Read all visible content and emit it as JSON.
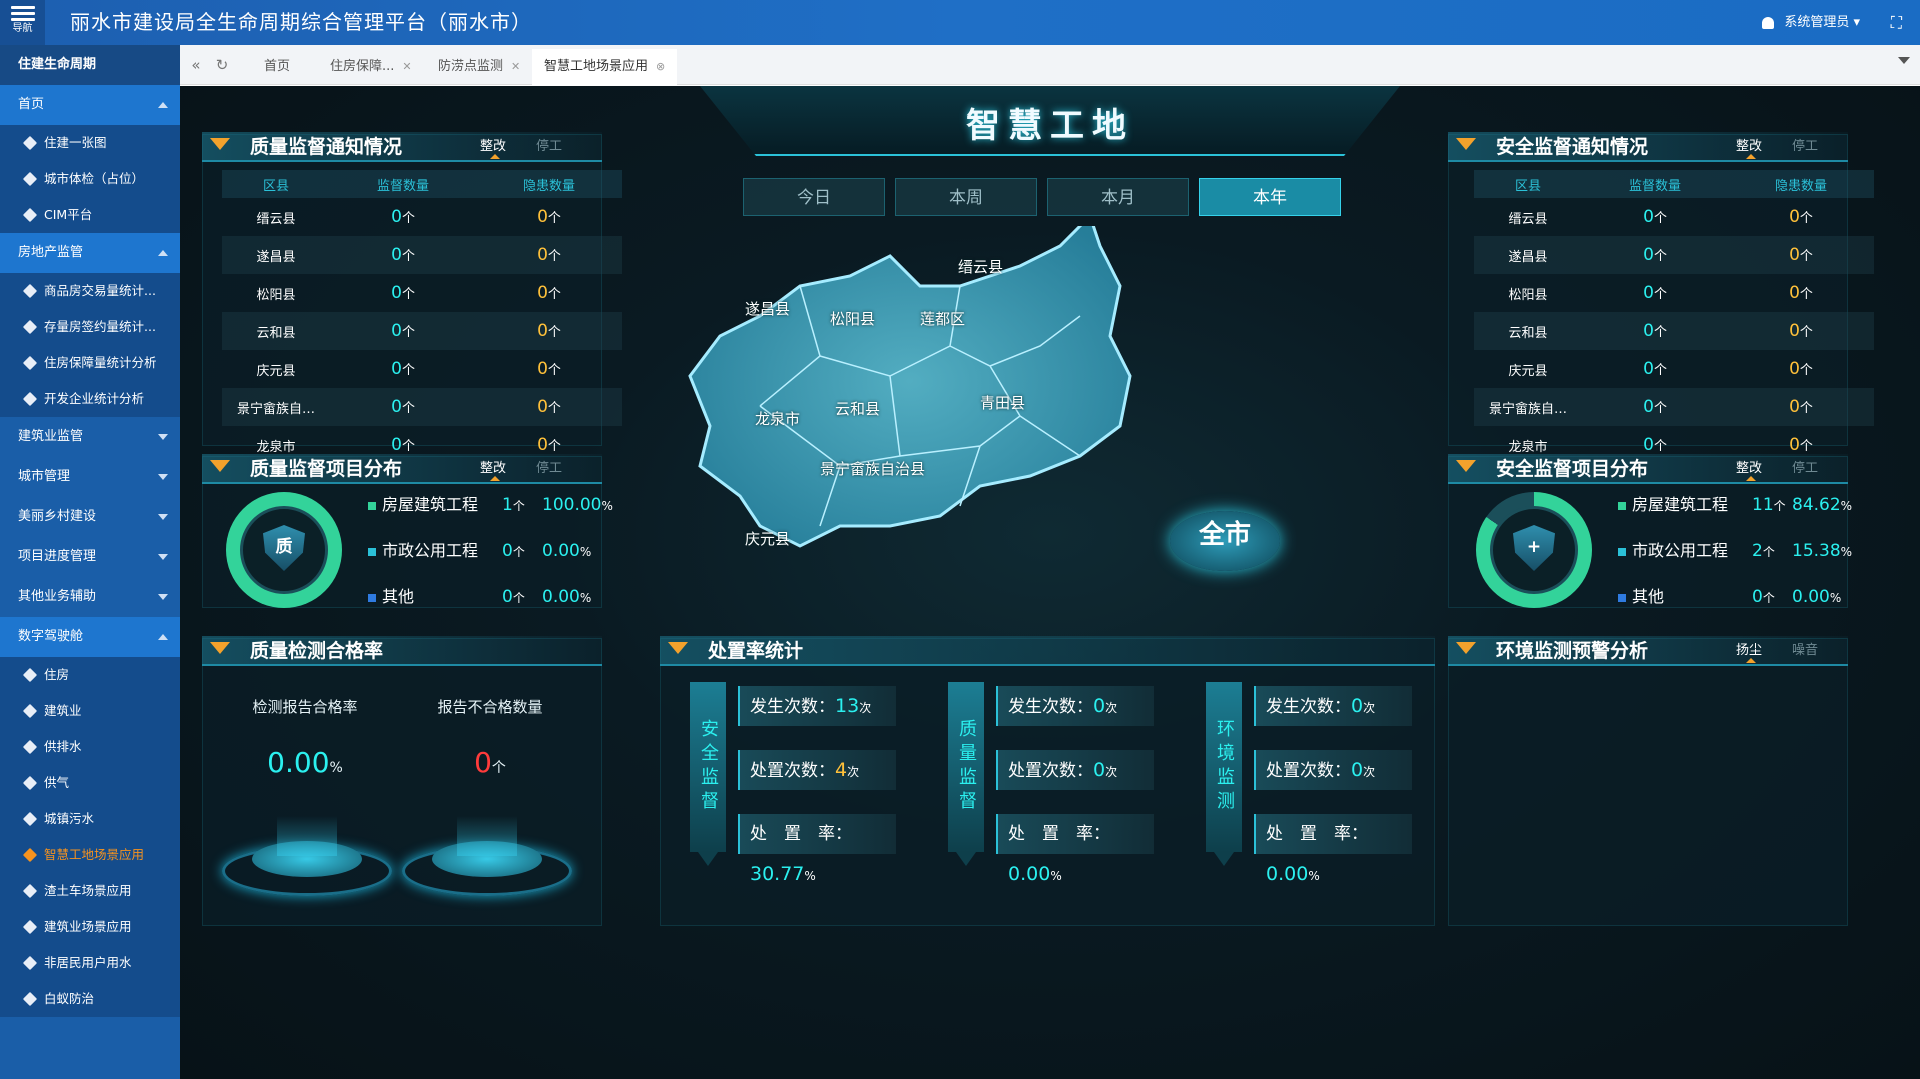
{
  "app": {
    "title": "丽水市建设局全生命周期综合管理平台（丽水市）",
    "menu_label": "导航",
    "user": "系统管理员"
  },
  "sidebar": {
    "head": "住建生命周期",
    "groups": [
      {
        "label": "首页",
        "open": true,
        "items": [
          "住建一张图",
          "城市体检（占位）",
          "CIM平台"
        ]
      },
      {
        "label": "房地产监管",
        "open": true,
        "items": [
          "商品房交易量统计...",
          "存量房签约量统计...",
          "住房保障量统计分析",
          "开发企业统计分析"
        ]
      },
      {
        "label": "建筑业监管",
        "open": false,
        "items": []
      },
      {
        "label": "城市管理",
        "open": false,
        "items": []
      },
      {
        "label": "美丽乡村建设",
        "open": false,
        "items": []
      },
      {
        "label": "项目进度管理",
        "open": false,
        "items": []
      },
      {
        "label": "其他业务辅助",
        "open": false,
        "items": []
      },
      {
        "label": "数字驾驶舱",
        "open": true,
        "items": [
          "住房",
          "建筑业",
          "供排水",
          "供气",
          "城镇污水",
          "智慧工地场景应用",
          "渣土车场景应用",
          "建筑业场景应用",
          "非居民用户用水",
          "白蚁防治"
        ]
      }
    ],
    "active_item": "智慧工地场景应用"
  },
  "tabs": [
    "首页",
    "住房保障...",
    "防涝点监测",
    "智慧工地场景应用"
  ],
  "dashboard": {
    "title": "智慧工地",
    "periods": [
      "今日",
      "本周",
      "本月",
      "本年"
    ],
    "active_period": "本年",
    "switch_labels": {
      "fix": "整改",
      "stop": "停工",
      "dust": "扬尘",
      "noise": "噪音"
    },
    "quality_notice": {
      "title": "质量监督通知情况",
      "headers": [
        "区县",
        "监督数量",
        "隐患数量"
      ],
      "rows": [
        {
          "area": "缙云县",
          "sup": "0",
          "risk": "0"
        },
        {
          "area": "遂昌县",
          "sup": "0",
          "risk": "0"
        },
        {
          "area": "松阳县",
          "sup": "0",
          "risk": "0"
        },
        {
          "area": "云和县",
          "sup": "0",
          "risk": "0"
        },
        {
          "area": "庆元县",
          "sup": "0",
          "risk": "0"
        },
        {
          "area": "景宁畲族自…",
          "sup": "0",
          "risk": "0"
        },
        {
          "area": "龙泉市",
          "sup": "0",
          "risk": "0"
        }
      ],
      "unit": "个"
    },
    "safety_notice": {
      "title": "安全监督通知情况",
      "headers": [
        "区县",
        "监督数量",
        "隐患数量"
      ],
      "rows": [
        {
          "area": "缙云县",
          "sup": "0",
          "risk": "0"
        },
        {
          "area": "遂昌县",
          "sup": "0",
          "risk": "0"
        },
        {
          "area": "松阳县",
          "sup": "0",
          "risk": "0"
        },
        {
          "area": "云和县",
          "sup": "0",
          "risk": "0"
        },
        {
          "area": "庆元县",
          "sup": "0",
          "risk": "0"
        },
        {
          "area": "景宁畲族自…",
          "sup": "0",
          "risk": "0"
        },
        {
          "area": "龙泉市",
          "sup": "0",
          "risk": "0"
        }
      ],
      "unit": "个"
    },
    "quality_dist": {
      "title": "质量监督项目分布",
      "shield": "质",
      "ring_fill": 1.0,
      "items": [
        {
          "label": "房屋建筑工程",
          "count": "1",
          "pct": "100.00",
          "color": "#33d39a"
        },
        {
          "label": "市政公用工程",
          "count": "0",
          "pct": "0.00",
          "color": "#2bc1d8"
        },
        {
          "label": "其他",
          "count": "0",
          "pct": "0.00",
          "color": "#2f7be0"
        }
      ]
    },
    "safety_dist": {
      "title": "安全监督项目分布",
      "shield": "+",
      "ring_fill": 0.8462,
      "items": [
        {
          "label": "房屋建筑工程",
          "count": "11",
          "pct": "84.62",
          "color": "#33d39a"
        },
        {
          "label": "市政公用工程",
          "count": "2",
          "pct": "15.38",
          "color": "#2bc1d8"
        },
        {
          "label": "其他",
          "count": "0",
          "pct": "0.00",
          "color": "#2f7be0"
        }
      ]
    },
    "units": {
      "count": "个",
      "pct": "%",
      "times": "次"
    },
    "map": {
      "labels": [
        "遂昌县",
        "松阳县",
        "莲都区",
        "缙云县",
        "龙泉市",
        "云和县",
        "青田县",
        "景宁畲族自治县",
        "庆元县"
      ],
      "city_button": "全市"
    },
    "qc_rate": {
      "title": "质量检测合格率",
      "pass_label": "检测报告合格率",
      "pass_value": "0.00",
      "fail_label": "报告不合格数量",
      "fail_value": "0"
    },
    "handling": {
      "title": "处置率统计",
      "occur_label": "发生次数：",
      "handled_label": "处置次数：",
      "rate_label": "处　置　率：",
      "groups": [
        {
          "name": "安全监督",
          "occur": "13",
          "handled": "4",
          "rate": "30.77"
        },
        {
          "name": "质量监督",
          "occur": "0",
          "handled": "0",
          "rate": "0.00"
        },
        {
          "name": "环境监测",
          "occur": "0",
          "handled": "0",
          "rate": "0.00"
        }
      ]
    },
    "env": {
      "title": "环境监测预警分析"
    }
  },
  "colors": {
    "accent": "#2bc1d8",
    "value": "#2bf0ef",
    "warn": "#ffc13a",
    "alert": "#ff3b3b",
    "active_nav": "#f7931e"
  }
}
